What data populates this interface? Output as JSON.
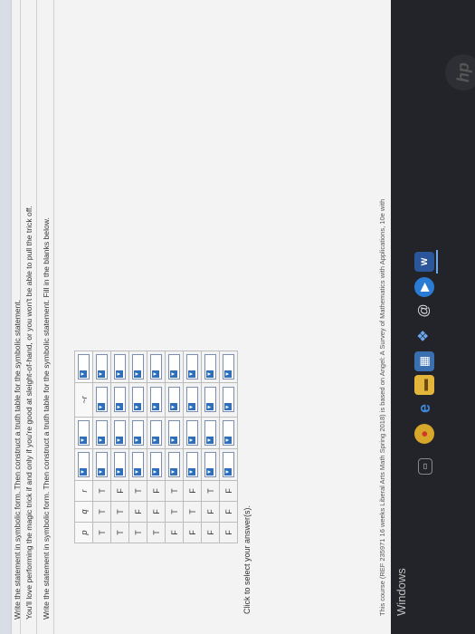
{
  "instructions": {
    "line1": "Write the statement in symbolic form. Then construct a truth table for the symbolic statement.",
    "line2": "You'll love performing the magic trick if and only if you're good at sleight-of-hand, or you won't be able to pull the trick off.",
    "line3": "Write the statement in symbolic form. Then construct a truth table for the symbolic statement. Fill in the blanks below."
  },
  "table": {
    "headers": {
      "p": "p",
      "q": "q",
      "r": "r",
      "neg": "~r"
    },
    "rows": [
      [
        "T",
        "T",
        "T"
      ],
      [
        "T",
        "T",
        "F"
      ],
      [
        "T",
        "F",
        "T"
      ],
      [
        "T",
        "F",
        "F"
      ],
      [
        "F",
        "T",
        "T"
      ],
      [
        "F",
        "T",
        "F"
      ],
      [
        "F",
        "F",
        "T"
      ],
      [
        "F",
        "F",
        "F"
      ]
    ],
    "dropdown_arrow": "▼"
  },
  "select_hint": "Click to select your answer(s).",
  "footer_note": "This course (REF 235971 16 weeks Liberal Arts Math Spring 2018) is based on Angel: A Survey of Mathematics with Applications, 10e with",
  "taskbar": {
    "windows_label": "Windows",
    "word_label": "W"
  },
  "colors": {
    "dropdown_accent": "#2f6fb9",
    "taskbar_bg": "#23232a"
  }
}
